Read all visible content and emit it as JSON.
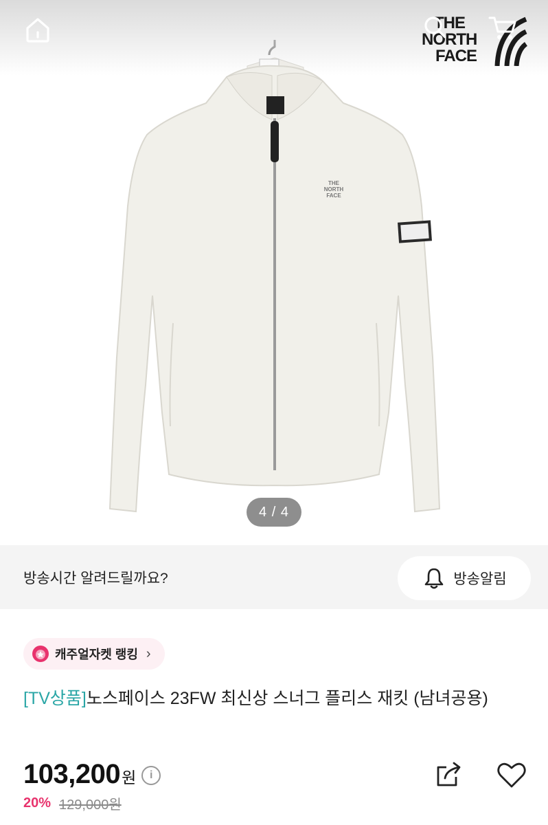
{
  "header": {
    "home_icon": "home-icon",
    "search_icon": "search-icon",
    "cart_icon": "cart-icon",
    "brand_logo": [
      "THE",
      "NORTH",
      "FACE"
    ]
  },
  "gallery": {
    "counter": "4 / 4",
    "jacket_logo": [
      "THE",
      "NORTH",
      "FACE"
    ]
  },
  "broadcast": {
    "prompt": "방송시간 알려드릴까요?",
    "button_label": "방송알림",
    "button_icon": "bell-icon"
  },
  "product": {
    "ranking_label": "캐주얼자켓 랭킹",
    "ranking_icon": "medal-icon",
    "title_tag": "[TV상품]",
    "title_text": "노스페이스 23FW 최신상 스너그 플리스 재킷 (남녀공용)",
    "price": "103,200",
    "currency": "원",
    "info_symbol": "i",
    "discount_rate": "20%",
    "original_price": "129,000원",
    "share_icon": "share-icon",
    "like_icon": "heart-icon"
  },
  "colors": {
    "accent_pink": "#e8336d",
    "tag_teal": "#2aa6a6",
    "chip_bg": "#fdf0f4"
  }
}
